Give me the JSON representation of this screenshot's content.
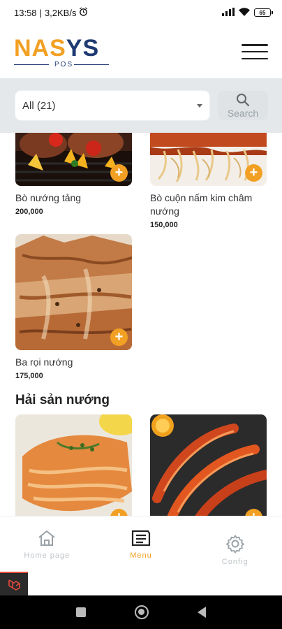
{
  "status_bar": {
    "time": "13:58",
    "speed": "3,2KB/s",
    "battery": "65"
  },
  "brand": {
    "logo_left": "NA",
    "logo_mid": "S",
    "logo_right": "YS",
    "logo_sub": "POS"
  },
  "filter": {
    "category_selected": "All (21)",
    "search_label": "Search"
  },
  "items": [
    {
      "name": "Bò nướng tảng",
      "price": "200,000"
    },
    {
      "name": "Bò cuộn nấm kim châm nướng",
      "price": "150,000"
    },
    {
      "name": "Ba rọi nướng",
      "price": "175,000"
    }
  ],
  "sections": {
    "seafood_title": "Hải sản nướng"
  },
  "nav": {
    "home": "Home page",
    "menu": "Menu",
    "config": "Config"
  },
  "colors": {
    "accent": "#f2a023",
    "brand_blue": "#1f3a73",
    "filter_bg": "#e4e8ea"
  }
}
